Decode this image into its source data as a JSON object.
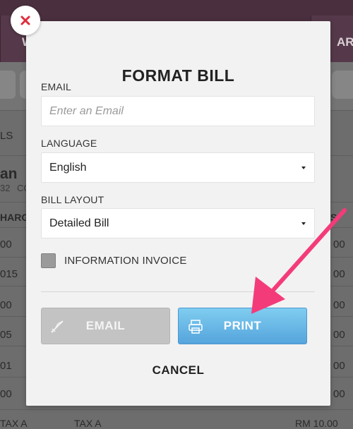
{
  "background": {
    "tabs": [
      "W",
      "AR"
    ],
    "left_labels": [
      "LS",
      "an",
      "32",
      "CO",
      "HARGE",
      "00",
      "015",
      "00",
      "05",
      "01",
      "00",
      "00"
    ],
    "right_labels": [
      "S",
      "00",
      "00",
      "00",
      "00",
      "00",
      "00"
    ],
    "bottom_row": {
      "left": "TAX A",
      "mid": "TAX A",
      "amount": "RM 10.00"
    }
  },
  "modal": {
    "title": "FORMAT BILL",
    "email": {
      "label": "EMAIL",
      "placeholder": "Enter an Email",
      "value": ""
    },
    "language": {
      "label": "LANGUAGE",
      "selected": "English"
    },
    "bill_layout": {
      "label": "BILL LAYOUT",
      "selected": "Detailed Bill"
    },
    "information_invoice": {
      "label": "INFORMATION INVOICE",
      "checked": false
    },
    "buttons": {
      "email": "EMAIL",
      "print": "PRINT",
      "cancel": "CANCEL"
    }
  },
  "colors": {
    "print_button": "#5aa9de",
    "email_button_disabled": "#c3c3c3",
    "close_x": "#e02d3c",
    "annotation_arrow": "#f43b7a"
  },
  "icons": {
    "close": "close-x-icon",
    "email": "send-icon",
    "print": "printer-icon",
    "arrow": "annotation-arrow"
  }
}
